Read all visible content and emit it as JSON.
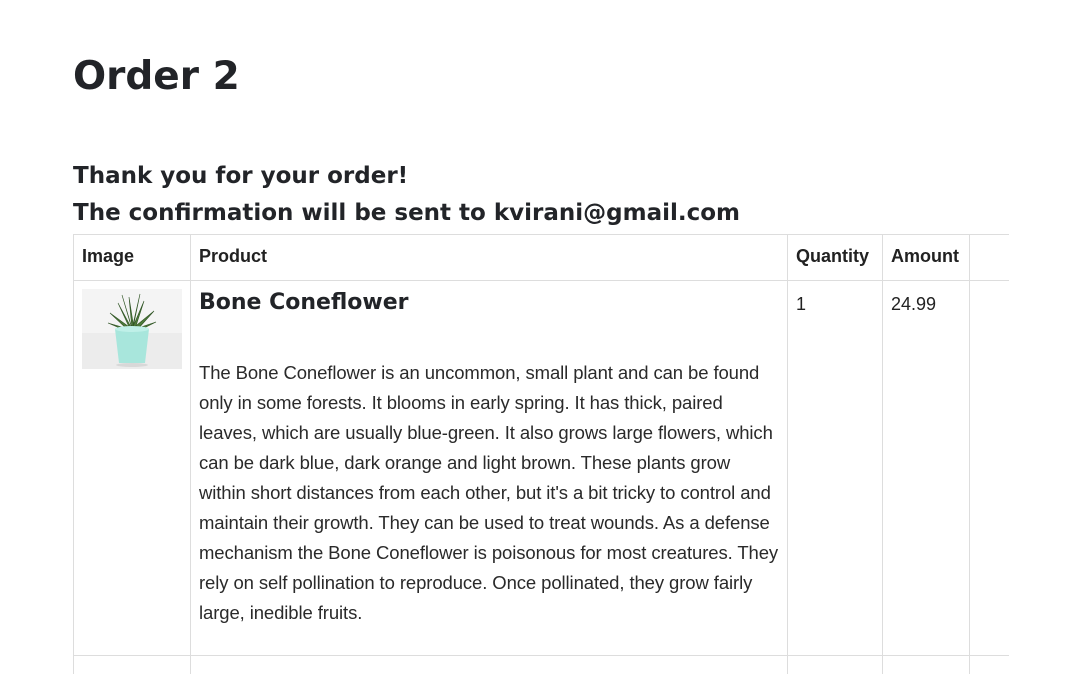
{
  "order": {
    "title": "Order 2",
    "thank_you": "Thank you for your order!",
    "confirmation": "The confirmation will be sent to kvirani@gmail.com"
  },
  "table": {
    "headers": {
      "image": "Image",
      "product": "Product",
      "quantity": "Quantity",
      "amount": "Amount"
    },
    "items": [
      {
        "image_alt": "Bone Coneflower",
        "name": "Bone Coneflower",
        "description": "The Bone Coneflower is an uncommon, small plant and can be found only in some forests. It blooms in early spring. It has thick, paired leaves, which are usually blue-green. It also grows large flowers, which can be dark blue, dark orange and light brown. These plants grow within short distances from each other, but it's a bit tricky to control and maintain their growth. They can be used to treat wounds. As a defense mechanism the Bone Coneflower is poisonous for most creatures. They rely on self pollination to reproduce. Once pollinated, they grow fairly large, inedible fruits.",
        "quantity": "1",
        "amount": "24.99"
      }
    ]
  },
  "colors": {
    "border": "#dddddd",
    "pot": "#a8e6dc",
    "leaf": "#4d7a3a"
  }
}
